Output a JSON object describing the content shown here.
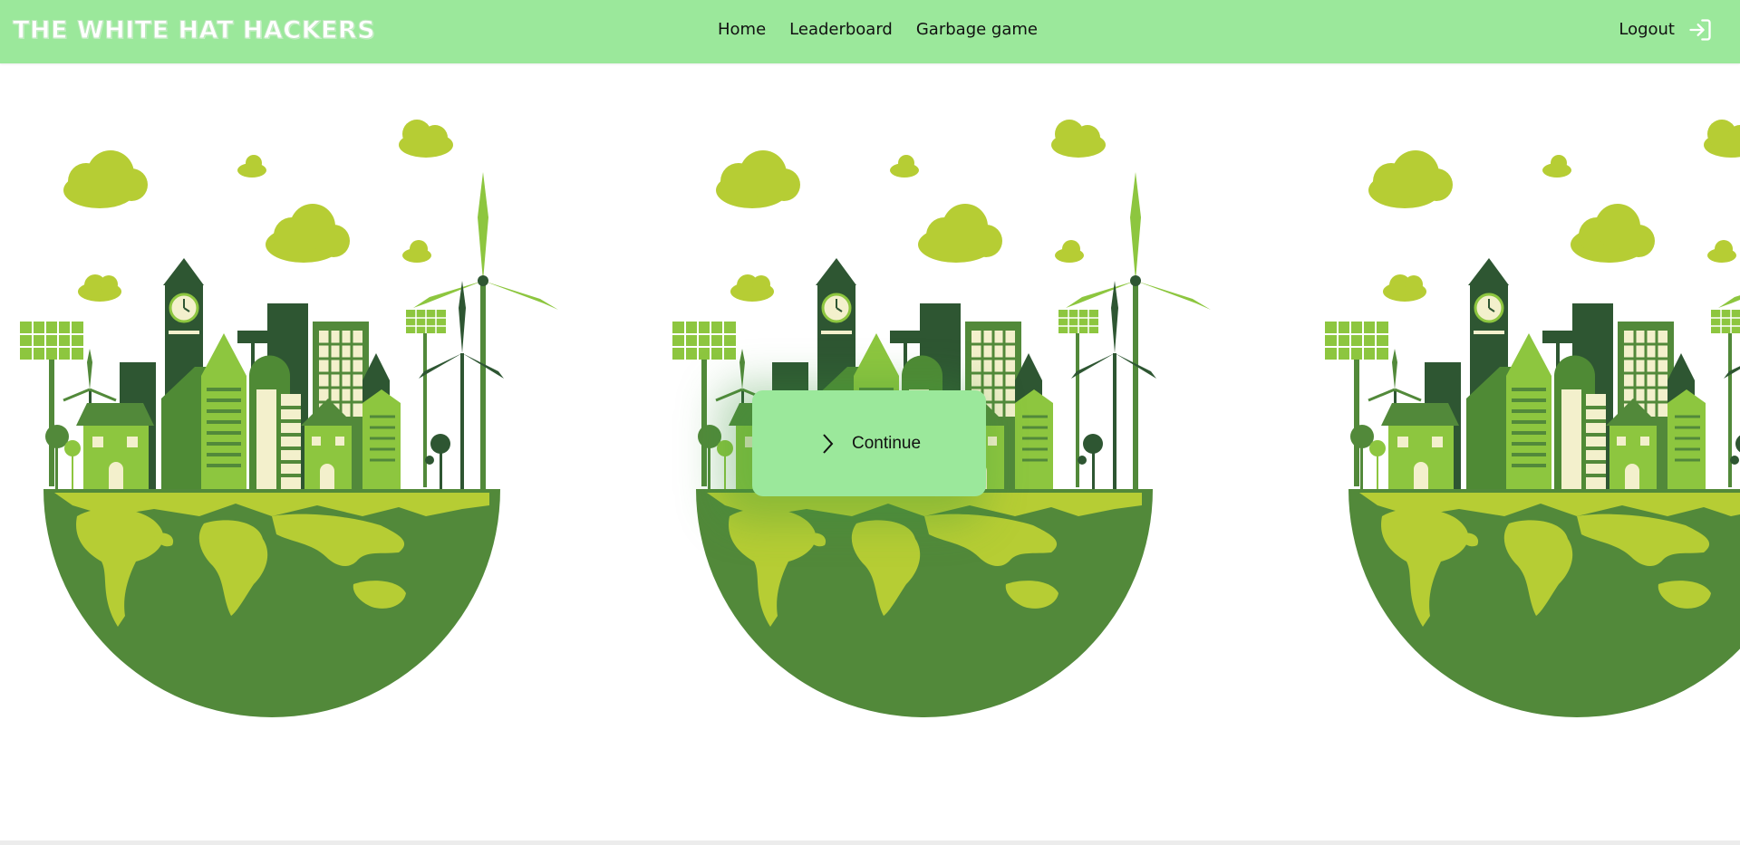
{
  "header": {
    "brand": "THE WHITE HAT HACKERS",
    "nav": [
      {
        "label": "Home"
      },
      {
        "label": "Leaderboard"
      },
      {
        "label": "Garbage game"
      }
    ],
    "logout_label": "Logout",
    "logout_icon": "logout-icon"
  },
  "carousel": {
    "slides": [
      {
        "image": "eco-city-globe"
      },
      {
        "image": "eco-city-globe"
      },
      {
        "image": "eco-city-globe"
      }
    ],
    "continue_label": "Continue",
    "continue_icon": "chevron-right-icon"
  },
  "colors": {
    "navbar": "#9be89b",
    "globe_dark": "#52893a",
    "land": "#b6cd34",
    "cloud": "#b6cd34",
    "building_dark": "#2e5632",
    "building_mid": "#4f8a35",
    "building_light": "#8dc63f",
    "window": "#f3f0cc"
  }
}
